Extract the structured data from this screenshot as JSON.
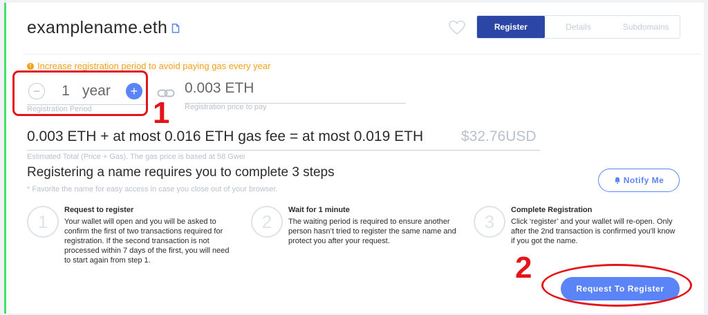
{
  "header": {
    "domain_name": "examplename.eth",
    "tabs": [
      {
        "label": "Register",
        "active": true
      },
      {
        "label": "Details",
        "active": false
      },
      {
        "label": "Subdomains",
        "active": false
      }
    ]
  },
  "registration": {
    "warning": "Increase registration period to avoid paying gas every year",
    "years_value": "1",
    "years_unit": "year",
    "period_label": "Registration Period",
    "price_value": "0.003 ETH",
    "price_label": "Registration price to pay",
    "total_text": "0.003 ETH + at most 0.016 ETH gas fee = at most 0.019 ETH",
    "total_usd": "$32.76USD",
    "total_label": "Estimated Total (Price + Gas). The gas price is based at 58 Gwei"
  },
  "steps_section": {
    "heading": "Registering a name requires you to complete 3 steps",
    "note": "* Favorite the name for easy access in case you close out of your browser.",
    "notify_label": "Notify Me",
    "steps": [
      {
        "number": "1",
        "title": "Request to register",
        "description": "Your wallet will open and you will be asked to confirm the first of two transactions required for registration. If the second transaction is not processed within 7 days of the first, you will need to start again from step 1."
      },
      {
        "number": "2",
        "title": "Wait for 1 minute",
        "description": "The waiting period is required to ensure another person hasn’t tried to register the same name and protect you after your request."
      },
      {
        "number": "3",
        "title": "Complete Registration",
        "description": "Click ‘register’ and your wallet will re-open. Only after the 2nd transaction is confirmed you'll know if you got the name."
      }
    ],
    "cta_label": "Request To Register"
  },
  "annotations": {
    "marker_1": "1",
    "marker_2": "2"
  },
  "colors": {
    "accent_blue": "#5b84f6",
    "tab_active": "#2c46a6",
    "warning": "#f2a01a",
    "annotation_red": "#e3151a",
    "left_bar_green": "#42e068"
  }
}
